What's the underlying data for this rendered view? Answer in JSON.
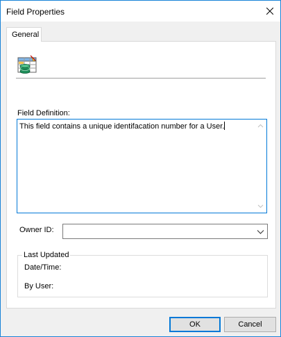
{
  "window": {
    "title": "Field Properties",
    "close_icon": "close-icon"
  },
  "tabs": [
    {
      "label": "General",
      "selected": true
    }
  ],
  "general": {
    "field_icon": "table-database-icon",
    "field_definition_label": "Field Definition:",
    "field_definition_value": "This field contains a unique identifacation number for a User.",
    "owner_id_label": "Owner ID:",
    "owner_id_value": "",
    "last_updated": {
      "title": "Last Updated",
      "date_time_label": "Date/Time:",
      "by_user_label": "By User:"
    }
  },
  "buttons": {
    "ok": "OK",
    "cancel": "Cancel"
  },
  "colors": {
    "accent": "#0078d7",
    "window_border": "#1883d7",
    "dialog_bg": "#f0f0f0"
  }
}
